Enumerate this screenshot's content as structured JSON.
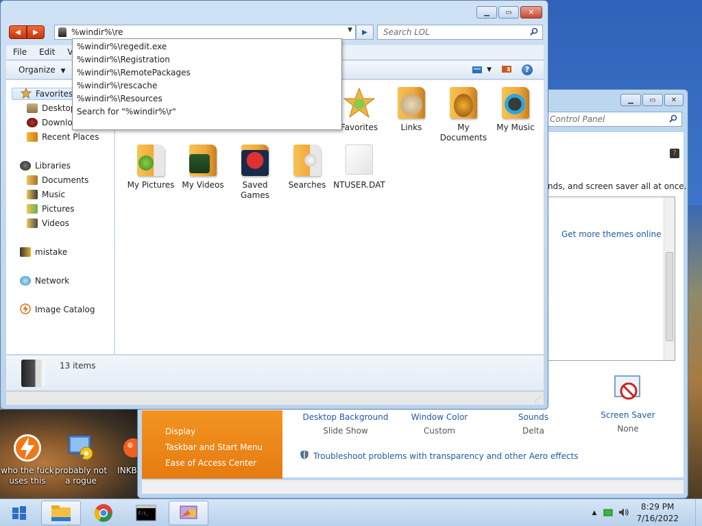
{
  "explorer": {
    "address_value": "%windir%\\re",
    "search_placeholder": "Search LOL",
    "menu": [
      "File",
      "Edit",
      "View"
    ],
    "organize_label": "Organize",
    "autocomplete": [
      "%windir%\\regedit.exe",
      "%windir%\\Registration",
      "%windir%\\RemotePackages",
      "%windir%\\rescache",
      "%windir%\\Resources",
      "Search for \"%windir%\\r\""
    ],
    "nav": {
      "favorites": "Favorites",
      "desktop": "Desktop",
      "downloads": "Downloads",
      "recent": "Recent Places",
      "libraries": "Libraries",
      "documents": "Documents",
      "music": "Music",
      "pictures": "Pictures",
      "videos": "Videos",
      "user": "mistake",
      "network": "Network",
      "image_catalog": "Image Catalog"
    },
    "items": {
      "favorites": "Favorites",
      "links": "Links",
      "my_documents": "My Documents",
      "my_music": "My Music",
      "my_pictures": "My Pictures",
      "my_videos": "My Videos",
      "saved_games": "Saved Games",
      "searches": "Searches",
      "ntuser": "NTUSER.DAT"
    },
    "status_count": "13 items"
  },
  "personalization": {
    "search_placeholder": "Control Panel",
    "description_fragment": "nds, and screen saver all at once.",
    "get_more": "Get more themes online",
    "left_links": [
      "Display",
      "Taskbar and Start Menu",
      "Ease of Access Center"
    ],
    "options": {
      "background": {
        "title": "Desktop Background",
        "value": "Slide Show"
      },
      "color": {
        "title": "Window Color",
        "value": "Custom"
      },
      "sounds": {
        "title": "Sounds",
        "value": "Delta"
      },
      "saver": {
        "title": "Screen Saver",
        "value": "None"
      }
    },
    "troubleshoot": "Troubleshoot problems with transparency and other Aero effects"
  },
  "desktop": {
    "icons": [
      "who the fuck uses this",
      "probably not a rogue",
      "INKBA"
    ]
  },
  "taskbar": {
    "time": "8:29 PM",
    "date": "7/16/2022"
  }
}
